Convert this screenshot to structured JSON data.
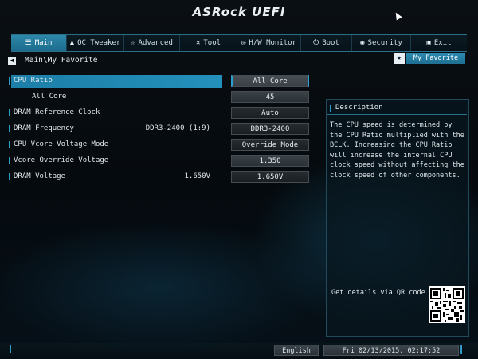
{
  "brand": {
    "logo_text": "ASRock UEFI"
  },
  "tabs": [
    {
      "label": "Main",
      "icon": "list-icon",
      "active": true
    },
    {
      "label": "OC Tweaker",
      "icon": "rocket-icon",
      "active": false
    },
    {
      "label": "Advanced",
      "icon": "star-icon",
      "active": false
    },
    {
      "label": "Tool",
      "icon": "tools-icon",
      "active": false
    },
    {
      "label": "H/W Monitor",
      "icon": "monitor-icon",
      "active": false
    },
    {
      "label": "Boot",
      "icon": "power-icon",
      "active": false
    },
    {
      "label": "Security",
      "icon": "shield-icon",
      "active": false
    },
    {
      "label": "Exit",
      "icon": "exit-icon",
      "active": false
    }
  ],
  "breadcrumb": "Main\\My Favorite",
  "my_favorite_label": "My Favorite",
  "settings": [
    {
      "label": "CPU Ratio",
      "current": "",
      "value": "All Core"
    },
    {
      "label": "All Core",
      "current": "",
      "value": "45"
    },
    {
      "label": "DRAM Reference Clock",
      "current": "",
      "value": "Auto"
    },
    {
      "label": "DRAM Frequency",
      "current": "DDR3-2400 (1:9)",
      "value": "DDR3-2400"
    },
    {
      "label": "CPU Vcore Voltage Mode",
      "current": "",
      "value": "Override Mode"
    },
    {
      "label": "Vcore Override Voltage",
      "current": "",
      "value": "1.350"
    },
    {
      "label": "DRAM Voltage",
      "current": "1.650V",
      "value": "1.650V"
    }
  ],
  "description": {
    "title": "Description",
    "text": "The CPU speed is determined by the CPU Ratio multiplied with the BCLK. Increasing the CPU Ratio will increase the internal CPU clock speed without affecting the clock speed of other components.",
    "qr_label": "Get details via QR code"
  },
  "footer": {
    "language": "English",
    "datetime": "Fri 02/13/2015. 02:17:52"
  },
  "colors": {
    "accent": "#2390bb",
    "tab_active": "#1c6c8c",
    "value_box": "#2a3035"
  }
}
